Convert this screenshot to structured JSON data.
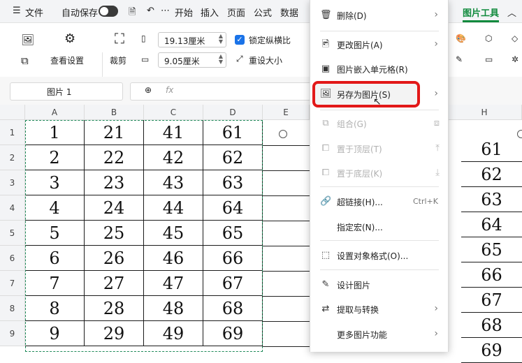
{
  "menubar": {
    "file": "文件",
    "autosave": "自动保存",
    "tabs": [
      "开始",
      "插入",
      "页面",
      "公式",
      "数据"
    ],
    "picture_tools": "图片工具"
  },
  "ribbon": {
    "view_settings": "查看设置",
    "crop": "裁剪",
    "width_value": "19.13厘米",
    "height_value": "9.05厘米",
    "lock_ratio": "锁定纵横比",
    "reset_size": "重设大小"
  },
  "formula": {
    "name_box": "图片 1",
    "fx": "fx"
  },
  "columns": [
    "A",
    "B",
    "C",
    "D",
    "E",
    "H"
  ],
  "rows": [
    "1",
    "2",
    "3",
    "4",
    "5",
    "6",
    "7",
    "8",
    "9"
  ],
  "table": [
    [
      "1",
      "21",
      "41",
      "61"
    ],
    [
      "2",
      "22",
      "42",
      "62"
    ],
    [
      "3",
      "23",
      "43",
      "63"
    ],
    [
      "4",
      "24",
      "44",
      "64"
    ],
    [
      "5",
      "25",
      "45",
      "65"
    ],
    [
      "6",
      "26",
      "46",
      "66"
    ],
    [
      "7",
      "27",
      "47",
      "67"
    ],
    [
      "8",
      "28",
      "48",
      "68"
    ],
    [
      "9",
      "29",
      "49",
      "69"
    ]
  ],
  "right_col": [
    "61",
    "62",
    "63",
    "64",
    "65",
    "66",
    "67",
    "68",
    "69"
  ],
  "context_menu": {
    "delete": "删除(D)",
    "change_picture": "更改图片(A)",
    "embed_cell": "图片嵌入单元格(R)",
    "save_as": "另存为图片(S)",
    "group": "组合(G)",
    "bring_front": "置于顶层(T)",
    "send_back": "置于底层(K)",
    "hyperlink": "超链接(H)...",
    "hyperlink_shortcut": "Ctrl+K",
    "assign_macro": "指定宏(N)...",
    "format_object": "设置对象格式(O)...",
    "design_picture": "设计图片",
    "extract_convert": "提取与转换",
    "more_features": "更多图片功能"
  },
  "colors": {
    "accent_green": "#118a3d",
    "highlight_red": "#e21818",
    "checkbox_blue": "#1a73e8"
  }
}
